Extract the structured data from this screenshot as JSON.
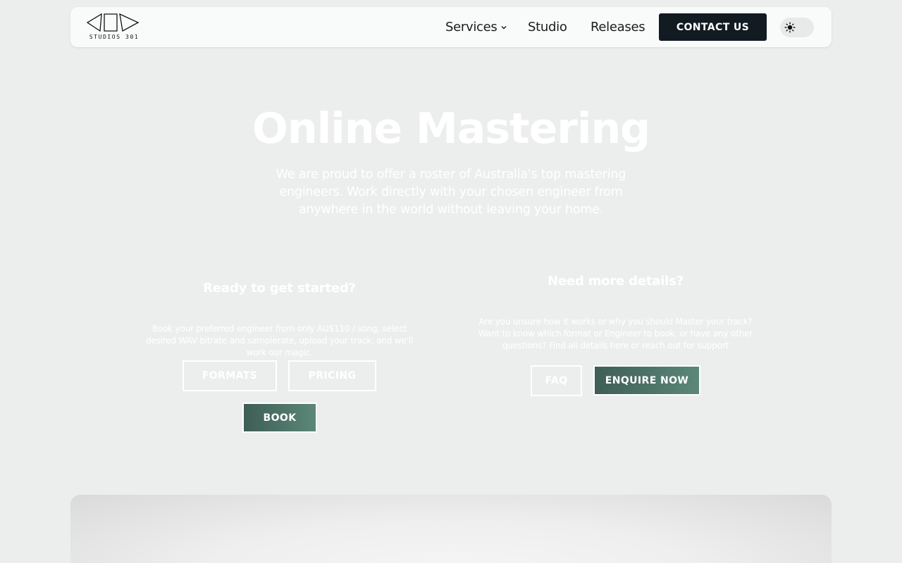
{
  "nav": {
    "logo_text": "STUDIOS 301",
    "links": [
      {
        "label": "Services"
      },
      {
        "label": "Studio"
      },
      {
        "label": "Releases"
      }
    ],
    "contact_label": "CONTACT US"
  },
  "hero": {
    "title": "Online Mastering",
    "subtitle": "We are proud to offer a roster of Australia's top mastering engineers. Work directly with your chosen engineer from anywhere in the world without leaving your home."
  },
  "left": {
    "heading": "Ready to get started?",
    "text": "Book your preferred engineer from only AU$110 / song, select desired WAV bitrate and samplerate, upload your track, and we'll work our magic.",
    "buttons": {
      "formats": "FORMATS",
      "pricing": "PRICING",
      "book": "BOOK"
    }
  },
  "right": {
    "heading": "Need more details?",
    "text": "Are you unsure how it works or why you should Master your track? Want to know which format or Engineer to book, or have any other questions? Find all details here or reach out for support",
    "buttons": {
      "faq": "FAQ",
      "enquire": "ENQUIRE NOW"
    }
  },
  "icons": [
    "logo",
    "chevron-down-icon",
    "sun-icon"
  ],
  "colors": {
    "background": "#eceeed",
    "nav_bg": "#f9fbfa",
    "contact_btn": "#121a22",
    "accent_gradient_start": "#3e5e55",
    "accent_gradient_end": "#5b8779"
  }
}
